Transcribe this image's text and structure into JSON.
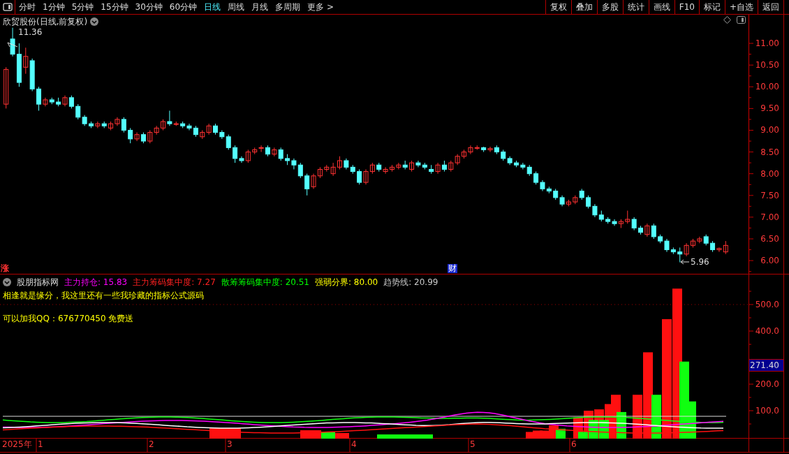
{
  "toolbar": {
    "periods": [
      {
        "label": "分时",
        "selected": false
      },
      {
        "label": "1分钟",
        "selected": false
      },
      {
        "label": "5分钟",
        "selected": false
      },
      {
        "label": "15分钟",
        "selected": false
      },
      {
        "label": "30分钟",
        "selected": false
      },
      {
        "label": "60分钟",
        "selected": false
      },
      {
        "label": "日线",
        "selected": true
      },
      {
        "label": "周线",
        "selected": false
      },
      {
        "label": "月线",
        "selected": false
      },
      {
        "label": "多周期",
        "selected": false
      },
      {
        "label": "更多 >",
        "selected": false
      }
    ],
    "buttons": [
      "复权",
      "叠加",
      "多股",
      "统计",
      "画线",
      "F10",
      "标记",
      "+自选",
      "返回"
    ]
  },
  "price_chart": {
    "title": "欣贸股份(日线,前复权)",
    "high_marker": "11.36",
    "low_marker": "5.96",
    "event_marks": [
      {
        "label": "涨",
        "color": "#ff3232"
      },
      {
        "label": "财",
        "color": "#1a2ad0"
      }
    ],
    "chart_data": {
      "type": "candlestick",
      "ylim": [
        5.68,
        11.66
      ],
      "categories": [
        null,
        null,
        null,
        null,
        null,
        null,
        null,
        null,
        null,
        null,
        null,
        null,
        null,
        null,
        null,
        null,
        null,
        null,
        null,
        null,
        null,
        null,
        null,
        null,
        null,
        null,
        null,
        null,
        null,
        null,
        null,
        null,
        null,
        null,
        null,
        null,
        null,
        null,
        null,
        null,
        null,
        null,
        null,
        null,
        null,
        null,
        null,
        null,
        null,
        null,
        null,
        null,
        null,
        null,
        null,
        null,
        null,
        null,
        null,
        null,
        null,
        null,
        null,
        null,
        null,
        null,
        null,
        null,
        null,
        null,
        null,
        null,
        null,
        null,
        null,
        null,
        null,
        null,
        null,
        null,
        null,
        null,
        null,
        null,
        null,
        null,
        null,
        null,
        null,
        null,
        null,
        null,
        null,
        null,
        null,
        null,
        null,
        null,
        null,
        null,
        null,
        null,
        null,
        null,
        null,
        null,
        null,
        null,
        null,
        null,
        null
      ],
      "yticks": [
        {
          "value": 11,
          "label": "11.00"
        },
        {
          "value": 10.5,
          "label": "10.50"
        },
        {
          "value": 10,
          "label": "10.00"
        },
        {
          "value": 9.5,
          "label": "9.50"
        },
        {
          "value": 9,
          "label": "9.00"
        },
        {
          "value": 8.5,
          "label": "8.50"
        },
        {
          "value": 8,
          "label": "8.00"
        },
        {
          "value": 7.5,
          "label": "7.50"
        },
        {
          "value": 7,
          "label": "7.00"
        },
        {
          "value": 6.5,
          "label": "6.50"
        },
        {
          "value": 6,
          "label": "6.00"
        }
      ],
      "ohlc": [
        [
          9.6,
          10.45,
          9.5,
          10.4
        ],
        [
          11.1,
          11.36,
          10.7,
          10.75
        ],
        [
          10.75,
          11.0,
          10.0,
          10.1
        ],
        [
          10.45,
          10.9,
          10.3,
          10.7
        ],
        [
          10.6,
          10.65,
          9.9,
          9.95
        ],
        [
          9.95,
          10.0,
          9.45,
          9.6
        ],
        [
          9.6,
          9.75,
          9.55,
          9.7
        ],
        [
          9.7,
          9.75,
          9.6,
          9.65
        ],
        [
          9.65,
          9.75,
          9.55,
          9.6
        ],
        [
          9.6,
          9.8,
          9.55,
          9.75
        ],
        [
          9.75,
          9.8,
          9.5,
          9.55
        ],
        [
          9.55,
          9.6,
          9.25,
          9.3
        ],
        [
          9.3,
          9.35,
          9.1,
          9.15
        ],
        [
          9.15,
          9.2,
          9.05,
          9.1
        ],
        [
          9.1,
          9.2,
          9.05,
          9.15
        ],
        [
          9.15,
          9.2,
          9.05,
          9.1
        ],
        [
          9.05,
          9.2,
          9.0,
          9.15
        ],
        [
          9.15,
          9.3,
          9.1,
          9.25
        ],
        [
          9.25,
          9.3,
          8.95,
          9.0
        ],
        [
          9.0,
          9.05,
          8.7,
          8.8
        ],
        [
          8.8,
          8.95,
          8.75,
          8.9
        ],
        [
          8.9,
          8.95,
          8.7,
          8.75
        ],
        [
          8.75,
          9.0,
          8.7,
          8.95
        ],
        [
          8.95,
          9.1,
          8.9,
          9.05
        ],
        [
          9.05,
          9.25,
          9.0,
          9.2
        ],
        [
          9.2,
          9.45,
          9.1,
          9.15
        ],
        [
          9.15,
          9.2,
          9.1,
          9.15
        ],
        [
          9.15,
          9.2,
          9.05,
          9.1
        ],
        [
          9.1,
          9.15,
          9.0,
          9.05
        ],
        [
          9.05,
          9.1,
          8.85,
          8.9
        ],
        [
          8.85,
          9.0,
          8.8,
          8.95
        ],
        [
          8.95,
          9.15,
          8.9,
          9.1
        ],
        [
          9.1,
          9.15,
          8.9,
          8.95
        ],
        [
          8.95,
          9.0,
          8.8,
          8.85
        ],
        [
          8.85,
          8.9,
          8.55,
          8.6
        ],
        [
          8.6,
          8.65,
          8.25,
          8.35
        ],
        [
          8.35,
          8.4,
          8.25,
          8.3
        ],
        [
          8.3,
          8.55,
          8.25,
          8.5
        ],
        [
          8.5,
          8.6,
          8.45,
          8.55
        ],
        [
          8.6,
          8.65,
          8.5,
          8.6
        ],
        [
          8.6,
          8.65,
          8.4,
          8.45
        ],
        [
          8.45,
          8.6,
          8.4,
          8.55
        ],
        [
          8.55,
          8.6,
          8.3,
          8.35
        ],
        [
          8.35,
          8.45,
          8.2,
          8.3
        ],
        [
          8.3,
          8.35,
          8.1,
          8.2
        ],
        [
          8.2,
          8.25,
          7.9,
          7.95
        ],
        [
          7.95,
          8.0,
          7.5,
          7.65
        ],
        [
          7.7,
          8.0,
          7.65,
          7.95
        ],
        [
          7.95,
          8.15,
          7.9,
          8.1
        ],
        [
          8.1,
          8.2,
          8.05,
          8.15
        ],
        [
          8.0,
          8.25,
          7.95,
          8.15
        ],
        [
          8.15,
          8.4,
          8.1,
          8.3
        ],
        [
          8.3,
          8.35,
          8.1,
          8.15
        ],
        [
          8.15,
          8.2,
          8.0,
          8.05
        ],
        [
          8.05,
          8.1,
          7.75,
          7.8
        ],
        [
          7.8,
          8.1,
          7.75,
          8.05
        ],
        [
          8.05,
          8.25,
          8.0,
          8.2
        ],
        [
          8.2,
          8.25,
          8.05,
          8.1
        ],
        [
          8.05,
          8.15,
          8.0,
          8.1
        ],
        [
          8.1,
          8.2,
          8.05,
          8.15
        ],
        [
          8.15,
          8.25,
          8.1,
          8.2
        ],
        [
          8.2,
          8.3,
          8.1,
          8.15
        ],
        [
          8.1,
          8.3,
          8.05,
          8.25
        ],
        [
          8.25,
          8.3,
          8.15,
          8.2
        ],
        [
          8.2,
          8.25,
          8.1,
          8.15
        ],
        [
          8.1,
          8.2,
          8.0,
          8.05
        ],
        [
          8.05,
          8.25,
          8.0,
          8.2
        ],
        [
          8.2,
          8.3,
          8.05,
          8.1
        ],
        [
          8.1,
          8.3,
          8.05,
          8.25
        ],
        [
          8.25,
          8.45,
          8.2,
          8.4
        ],
        [
          8.4,
          8.55,
          8.35,
          8.5
        ],
        [
          8.5,
          8.65,
          8.45,
          8.6
        ],
        [
          8.6,
          8.65,
          8.55,
          8.6
        ],
        [
          8.6,
          8.62,
          8.5,
          8.55
        ],
        [
          8.55,
          8.62,
          8.5,
          8.58
        ],
        [
          8.6,
          8.65,
          8.45,
          8.5
        ],
        [
          8.5,
          8.55,
          8.3,
          8.35
        ],
        [
          8.35,
          8.4,
          8.2,
          8.25
        ],
        [
          8.25,
          8.3,
          8.15,
          8.2
        ],
        [
          8.2,
          8.25,
          8.1,
          8.15
        ],
        [
          8.15,
          8.2,
          7.95,
          8.0
        ],
        [
          8.0,
          8.05,
          7.75,
          7.8
        ],
        [
          7.8,
          7.85,
          7.6,
          7.65
        ],
        [
          7.65,
          7.7,
          7.55,
          7.6
        ],
        [
          7.6,
          7.65,
          7.4,
          7.45
        ],
        [
          7.45,
          7.5,
          7.25,
          7.3
        ],
        [
          7.3,
          7.4,
          7.25,
          7.35
        ],
        [
          7.35,
          7.5,
          7.3,
          7.45
        ],
        [
          7.6,
          7.65,
          7.4,
          7.45
        ],
        [
          7.45,
          7.5,
          7.2,
          7.25
        ],
        [
          7.25,
          7.3,
          7.0,
          7.05
        ],
        [
          7.05,
          7.15,
          6.9,
          6.95
        ],
        [
          6.95,
          7.0,
          6.85,
          6.9
        ],
        [
          6.9,
          6.95,
          6.8,
          6.85
        ],
        [
          6.85,
          6.95,
          6.75,
          6.9
        ],
        [
          6.9,
          7.15,
          6.85,
          6.95
        ],
        [
          6.95,
          7.0,
          6.7,
          6.75
        ],
        [
          6.75,
          6.8,
          6.6,
          6.65
        ],
        [
          6.6,
          6.85,
          6.55,
          6.8
        ],
        [
          6.8,
          6.85,
          6.5,
          6.55
        ],
        [
          6.55,
          6.6,
          6.4,
          6.45
        ],
        [
          6.45,
          6.5,
          6.2,
          6.25
        ],
        [
          6.25,
          6.3,
          6.15,
          6.2
        ],
        [
          6.2,
          6.3,
          5.96,
          6.15
        ],
        [
          6.15,
          6.4,
          6.1,
          6.35
        ],
        [
          6.35,
          6.5,
          6.3,
          6.45
        ],
        [
          6.45,
          6.55,
          6.4,
          6.5
        ],
        [
          6.55,
          6.6,
          6.35,
          6.4
        ],
        [
          6.4,
          6.45,
          6.2,
          6.25
        ],
        [
          6.25,
          6.3,
          6.2,
          6.28
        ],
        [
          6.2,
          6.45,
          6.15,
          6.35
        ]
      ]
    }
  },
  "indicator": {
    "name": "股朋指标网",
    "legend": [
      {
        "text": "主力持仓: 15.83",
        "color": "#ff00ff"
      },
      {
        "text": "主力筹码集中度: 7.27",
        "color": "#ff2020"
      },
      {
        "text": "散筹筹码集中度: 20.51",
        "color": "#00ff00"
      },
      {
        "text": "强弱分界: 80.00",
        "color": "#ffff00"
      },
      {
        "text": "趋势线: 20.99",
        "color": "#c8c8c8"
      }
    ],
    "notes": [
      "相逢就是缘分，我这里还有一些我珍藏的指标公式源码",
      "可以加我QQ：676770450 免费送"
    ],
    "axis_ticks": [
      "500.0",
      "400.0",
      "200.0",
      "100.0"
    ],
    "current_value": "271.40"
  },
  "date_axis": [
    "2025年",
    "1",
    "2",
    "3",
    "4",
    "5",
    "6"
  ]
}
